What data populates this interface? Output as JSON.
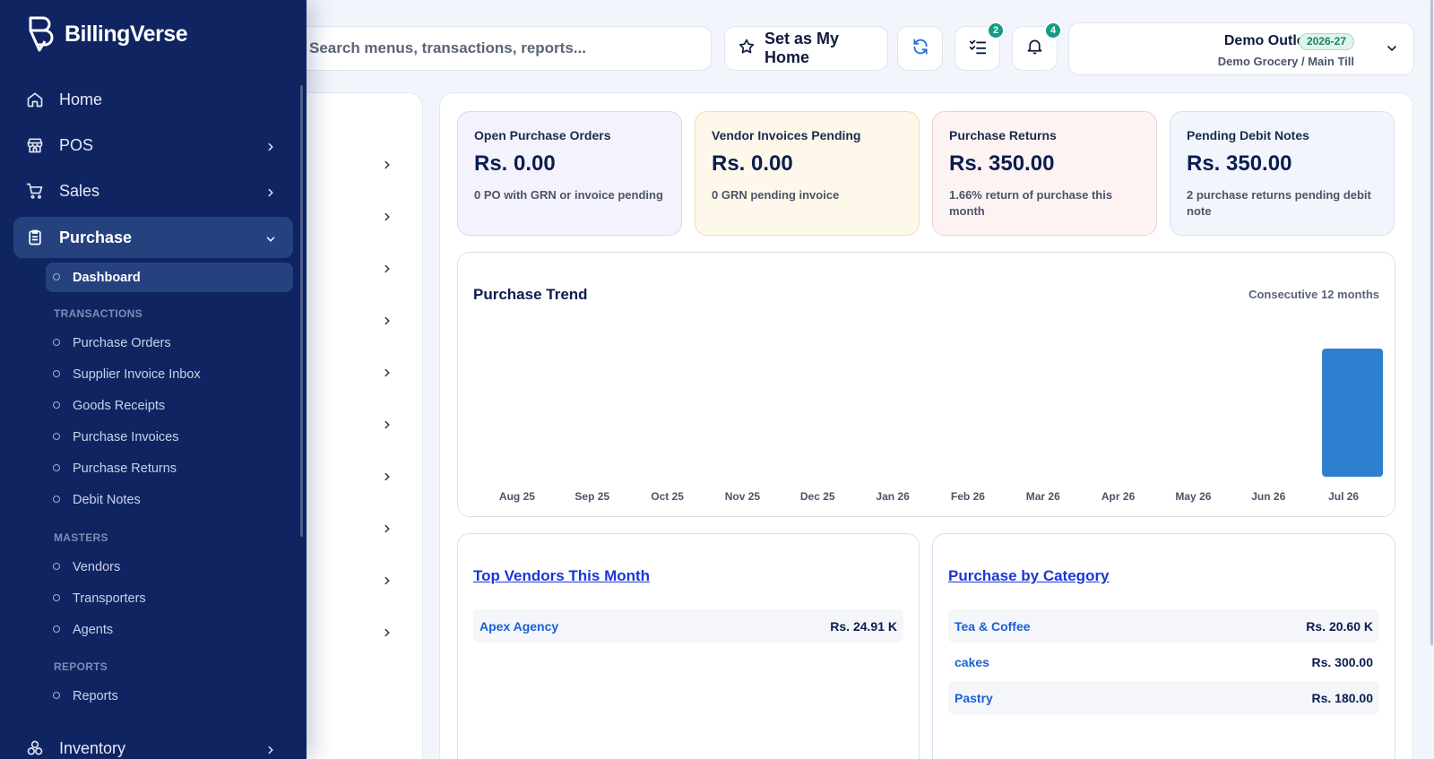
{
  "brand": {
    "name": "BillingVerse"
  },
  "search": {
    "placeholder": "Search menus, transactions, reports..."
  },
  "toolbar": {
    "home_label": "Set as My Home",
    "refresh_icon": "refresh-icon",
    "tasks_badge": "2",
    "notifications_badge": "4"
  },
  "outlet": {
    "name": "Demo Outlet",
    "year": "2026-27",
    "sub": "Demo Grocery / Main Till"
  },
  "sidebar": {
    "home": "Home",
    "pos": "POS",
    "sales": "Sales",
    "purchase": "Purchase",
    "dashboard": "Dashboard",
    "sections": {
      "transactions": "TRANSACTIONS",
      "masters": "MASTERS",
      "reports": "REPORTS"
    },
    "transactions": [
      "Purchase Orders",
      "Supplier Invoice Inbox",
      "Goods Receipts",
      "Purchase Invoices",
      "Purchase Returns",
      "Debit Notes"
    ],
    "masters": [
      "Vendors",
      "Transporters",
      "Agents"
    ],
    "reports": [
      "Reports"
    ],
    "inventory": "Inventory"
  },
  "kpis": [
    {
      "title": "Open Purchase Orders",
      "value": "Rs. 0.00",
      "sub": "0 PO with GRN or invoice pending"
    },
    {
      "title": "Vendor Invoices Pending",
      "value": "Rs. 0.00",
      "sub": "0 GRN pending invoice"
    },
    {
      "title": "Purchase Returns",
      "value": "Rs. 350.00",
      "sub": "1.66% return of purchase this month"
    },
    {
      "title": "Pending Debit Notes",
      "value": "Rs. 350.00",
      "sub": "2 purchase returns pending debit note"
    }
  ],
  "trend": {
    "title": "Purchase Trend",
    "note": "Consecutive 12 months"
  },
  "chart_data": {
    "type": "bar",
    "categories": [
      "Aug 25",
      "Sep 25",
      "Oct 25",
      "Nov 25",
      "Dec 25",
      "Jan 26",
      "Feb 26",
      "Mar 26",
      "Apr 26",
      "May 26",
      "Jun 26",
      "Jul 26"
    ],
    "values": [
      0,
      0,
      0,
      0,
      0,
      0,
      0,
      0,
      0,
      0,
      0,
      1
    ],
    "color": "#2f7fd1"
  },
  "top_vendors": {
    "title": "Top Vendors This Month",
    "rows": [
      {
        "name": "Apex Agency",
        "amount": "Rs. 24.91 K"
      }
    ]
  },
  "category": {
    "title": "Purchase by Category",
    "rows": [
      {
        "name": "Tea & Coffee",
        "amount": "Rs. 20.60 K"
      },
      {
        "name": "cakes",
        "amount": "Rs. 300.00"
      },
      {
        "name": "Pastry",
        "amount": "Rs. 180.00"
      }
    ]
  }
}
